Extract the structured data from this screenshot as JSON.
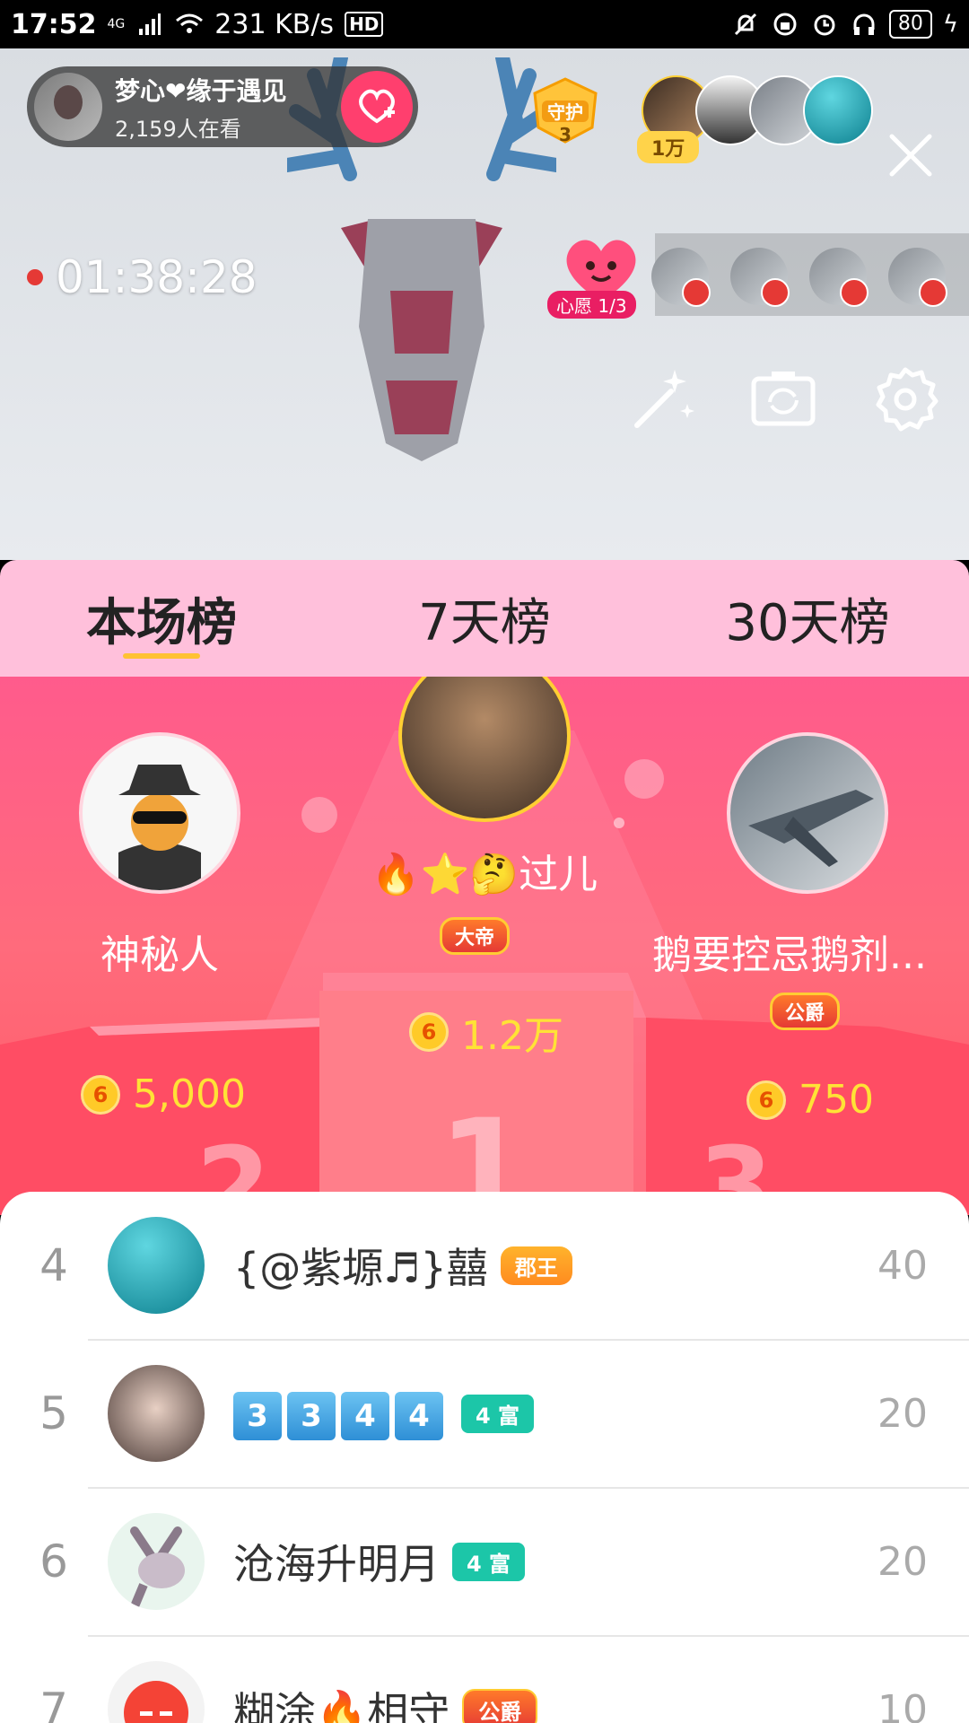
{
  "status_bar": {
    "time": "17:52",
    "network": "4G",
    "speed": "231 KB/s",
    "hd": "HD",
    "battery": "80"
  },
  "streamer": {
    "name": "梦心❤缘于遇见",
    "viewers": "2,159人在看"
  },
  "guard": {
    "label": "守护",
    "count": "3"
  },
  "audience": {
    "badge": "1万"
  },
  "timer": "01:38:28",
  "wish": {
    "label": "心愿 1/3"
  },
  "tabs": [
    {
      "label": "本场榜",
      "active": true
    },
    {
      "label": "7天榜",
      "active": false
    },
    {
      "label": "30天榜",
      "active": false
    }
  ],
  "podium": {
    "first": {
      "name": "🔥⭐🤔过儿",
      "badge": "大帝",
      "coins": "1.2万"
    },
    "second": {
      "name": "神秘人",
      "coins": "5,000"
    },
    "third": {
      "name": "鹅要控忌鹅剂...",
      "badge": "公爵",
      "coins": "750"
    }
  },
  "coin_symbol": "6",
  "ranking": [
    {
      "rank": "4",
      "name": "{@紫塬♬}囍",
      "badge": "郡王",
      "score": "40"
    },
    {
      "rank": "5",
      "name": "3344",
      "badge": "4 富",
      "score": "20"
    },
    {
      "rank": "6",
      "name": "沧海升明月",
      "badge": "4 富",
      "score": "20"
    },
    {
      "rank": "7",
      "name": "糊涂🔥相守",
      "badge": "公爵",
      "score": "10"
    }
  ],
  "colors": {
    "tab_bg": "#ffc0db",
    "podium_bg": "#ff5b8c",
    "coin_text": "#ffe236",
    "teal_badge": "#1cc6a8"
  }
}
